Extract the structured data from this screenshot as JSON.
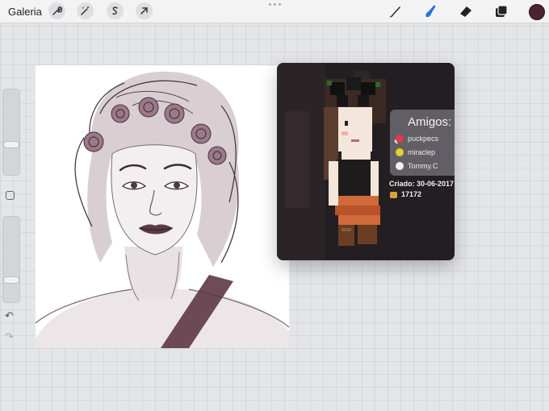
{
  "toolbar": {
    "gallery_label": "Galeria",
    "left_tools": [
      "wrench-icon",
      "magic-wand-icon",
      "selection-icon",
      "transform-arrow-icon"
    ],
    "right_tools": [
      "brush-icon",
      "smudge-icon",
      "eraser-icon",
      "layers-icon"
    ],
    "current_color": "#4c2431"
  },
  "sidebar": {
    "size_slider_level": 0.7,
    "opacity_slider_level": 0.25
  },
  "reference_photo": {
    "friends_title": "Amigos:",
    "friends": [
      {
        "name": "puckpecs",
        "icon": "heart-icon",
        "icon_color": "#e03b4a"
      },
      {
        "name": "miraclep",
        "icon": "smiley-icon",
        "icon_color": "#e8cf2b"
      },
      {
        "name": "Tommy.C",
        "icon": "skull-icon",
        "icon_color": "#f2f2f2"
      }
    ],
    "created_label": "Criado: 30-06-2017",
    "coins": "17172"
  }
}
